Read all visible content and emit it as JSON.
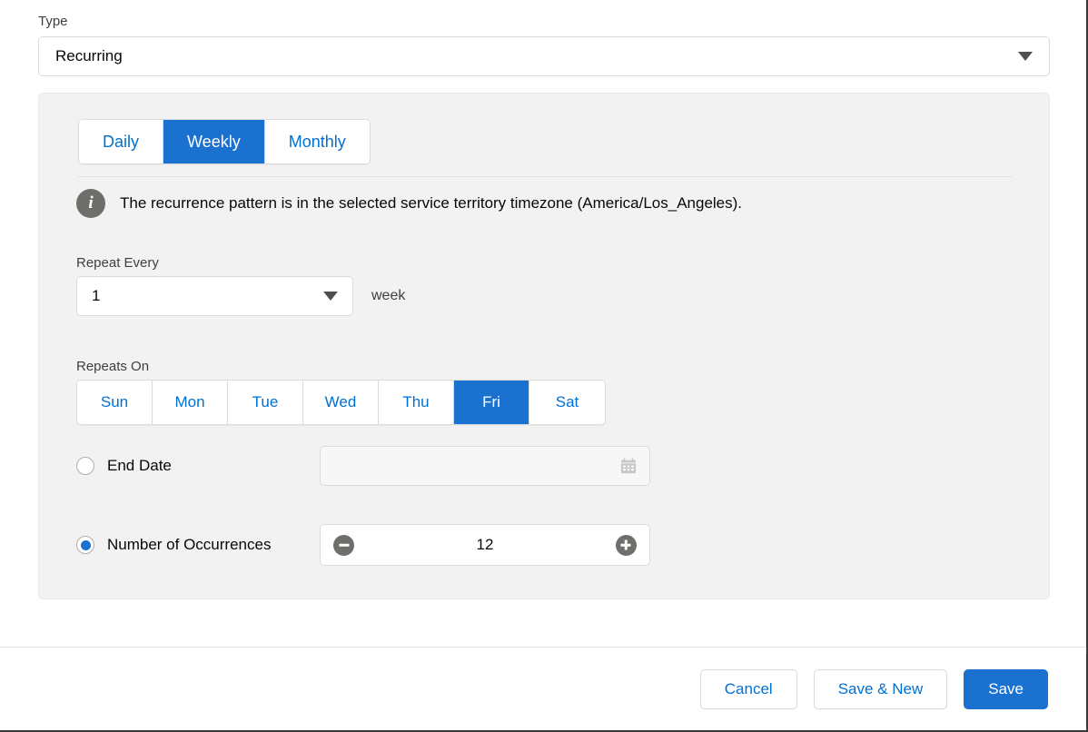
{
  "type_field": {
    "label": "Type",
    "value": "Recurring",
    "caret_icon": "chevron-down-icon"
  },
  "recurrence": {
    "tabs": [
      {
        "label": "Daily",
        "active": false
      },
      {
        "label": "Weekly",
        "active": true
      },
      {
        "label": "Monthly",
        "active": false
      }
    ],
    "info": {
      "icon": "info-icon",
      "message": "The recurrence pattern is in the selected service territory timezone (America/Los_Angeles)."
    },
    "repeat_every": {
      "label": "Repeat Every",
      "value": "1",
      "unit": "week"
    },
    "repeats_on": {
      "label": "Repeats On",
      "days": [
        {
          "label": "Sun",
          "selected": false
        },
        {
          "label": "Mon",
          "selected": false
        },
        {
          "label": "Tue",
          "selected": false
        },
        {
          "label": "Wed",
          "selected": false
        },
        {
          "label": "Thu",
          "selected": false
        },
        {
          "label": "Fri",
          "selected": true
        },
        {
          "label": "Sat",
          "selected": false
        }
      ]
    },
    "end_date": {
      "label": "End Date",
      "selected": false,
      "value": "",
      "placeholder": "",
      "icon": "calendar-icon"
    },
    "occurrences": {
      "label": "Number of Occurrences",
      "selected": true,
      "value": "12",
      "decrement_icon": "minus-circle-icon",
      "increment_icon": "plus-circle-icon"
    }
  },
  "footer": {
    "cancel_label": "Cancel",
    "save_new_label": "Save & New",
    "save_label": "Save"
  },
  "colors": {
    "accent": "#1b71d0",
    "link": "#0070d2",
    "panel_bg": "#f3f2f2",
    "text": "#080707",
    "muted": "#706e6b"
  }
}
